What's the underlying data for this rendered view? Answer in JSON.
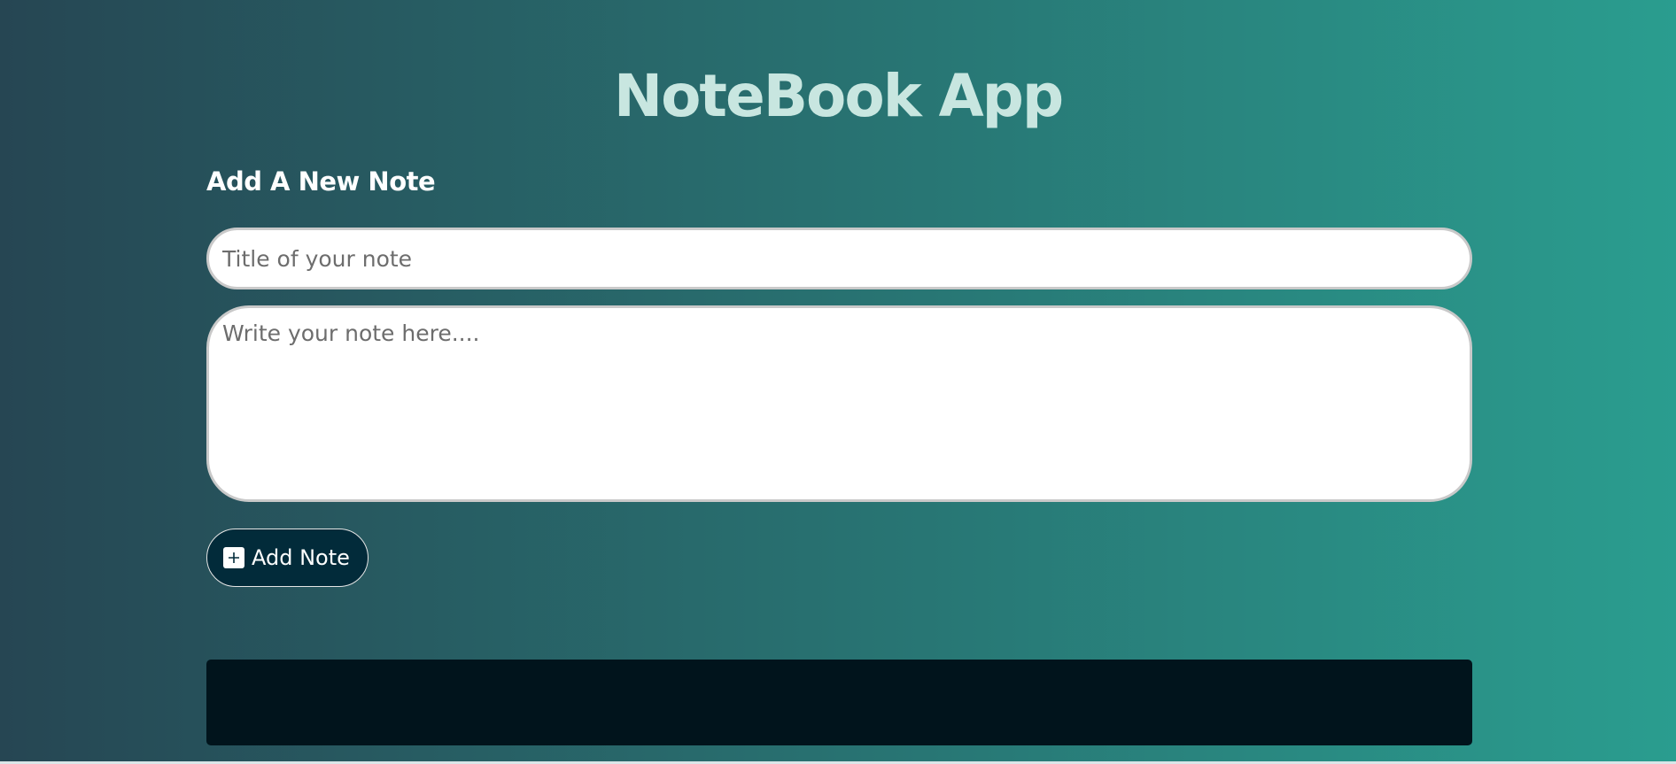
{
  "app": {
    "title": "NoteBook App"
  },
  "form": {
    "heading": "Add A New Note",
    "title_input": {
      "value": "",
      "placeholder": "Title of your note"
    },
    "note_textarea": {
      "value": "",
      "placeholder": "Write your note here...."
    },
    "add_button": {
      "label": "Add Note",
      "icon": "plus-square-icon"
    }
  },
  "notes": {
    "items": []
  },
  "colors": {
    "background_start": "#264653",
    "background_end": "#2a9d8f",
    "title": "#c8e6e0",
    "button_bg": "#022b3a",
    "notes_bar": "#01141c"
  }
}
